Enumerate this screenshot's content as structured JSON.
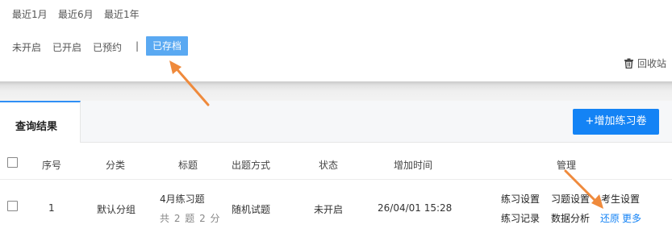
{
  "date_filters": [
    "最近1月",
    "最近6月",
    "最近1年"
  ],
  "status_filters": [
    "未开启",
    "已开启",
    "已预约"
  ],
  "separator": "|",
  "active_filter": "已存档",
  "recycle_label": "回收站",
  "results_tab": "查询结果",
  "add_button": "+增加练习卷",
  "columns": [
    "序号",
    "分类",
    "标题",
    "出题方式",
    "状态",
    "增加时间",
    "管理"
  ],
  "row": {
    "index": "1",
    "category": "默认分组",
    "title": "4月练习题",
    "subtitle": "共 2 题 2 分",
    "method": "随机试题",
    "status": "未开启",
    "time": "26/04/01 15:28",
    "actions_line1": [
      "练习设置",
      "习题设置",
      "考生设置"
    ],
    "actions_line2": [
      "练习记录",
      "数据分析"
    ],
    "links": [
      "还原",
      "更多"
    ]
  },
  "colors": {
    "accent": "#1483f5",
    "active_filter_bg": "#5aa9f2",
    "arrow": "#ef8a3c"
  },
  "icons": [
    "trash-icon",
    "arrow-annotation"
  ]
}
